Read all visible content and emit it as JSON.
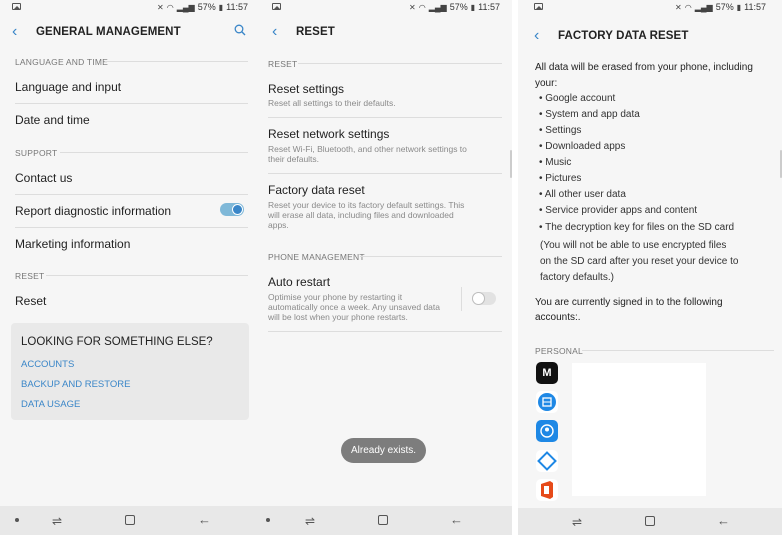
{
  "status": {
    "battery": "57%",
    "time": "11:57"
  },
  "general": {
    "title": "GENERAL MANAGEMENT",
    "sections": {
      "language_time": "LANGUAGE AND TIME",
      "support": "SUPPORT",
      "reset": "RESET"
    },
    "items": {
      "language_input": "Language and input",
      "date_time": "Date and time",
      "contact_us": "Contact us",
      "report_diag": "Report diagnostic information",
      "marketing": "Marketing information",
      "reset": "Reset"
    },
    "report_diag_toggle": "on",
    "card": {
      "title": "LOOKING FOR SOMETHING ELSE?",
      "links": [
        "ACCOUNTS",
        "BACKUP AND RESTORE",
        "DATA USAGE"
      ]
    }
  },
  "reset_screen": {
    "title": "RESET",
    "sections": {
      "reset": "RESET",
      "phone_mgmt": "PHONE MANAGEMENT"
    },
    "items": {
      "reset_settings": {
        "label": "Reset settings",
        "desc": "Reset all settings to their defaults."
      },
      "reset_network": {
        "label": "Reset network settings",
        "desc_1": "Reset Wi-Fi, Bluetooth, and other network settings to",
        "desc_2": "their defaults."
      },
      "factory_reset": {
        "label": "Factory data reset",
        "desc_1": "Reset your device to its factory default settings. This",
        "desc_2": "will erase all data, including files and downloaded",
        "desc_3": "apps."
      },
      "auto_restart": {
        "label": "Auto restart",
        "desc_1": "Optimise your phone by restarting it",
        "desc_2": "automatically once a week. Any unsaved data",
        "desc_3": "will be lost when your phone restarts."
      }
    },
    "auto_restart_toggle": "off",
    "toast": "Already exists."
  },
  "factory": {
    "title": "FACTORY DATA RESET",
    "intro_1": "All data will be erased from your phone, including",
    "intro_2": "your:",
    "bullets": [
      "Google account",
      "System and app data",
      "Settings",
      "Downloaded apps",
      "Music",
      "Pictures",
      "All other user data",
      "Service provider apps and content",
      "The decryption key for files on the SD card"
    ],
    "note_1": "(You will not be able to use encrypted files",
    "note_2": "on the SD card after you reset your device to",
    "note_3": "factory defaults.)",
    "signed_1": "You are currently signed in to the following",
    "signed_2": "accounts:.",
    "personal": "PERSONAL",
    "account_icons": [
      "medium-icon",
      "qr-scanner-icon",
      "samsung-account-icon",
      "sync-icon",
      "office-icon"
    ],
    "colors": {
      "medium": "#111111",
      "blue": "#1e88e5",
      "office": "#e64a19"
    }
  },
  "colors": {
    "accent": "#3a86c8",
    "background": "#f6f6f6",
    "navbar": "#e8e8e8"
  }
}
